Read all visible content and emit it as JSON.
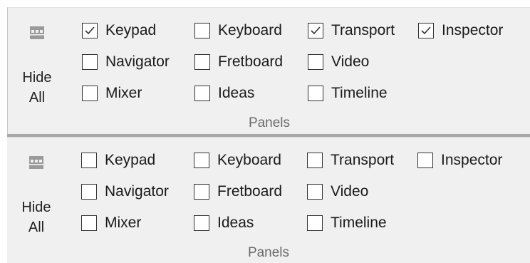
{
  "panels": [
    {
      "hide_all": {
        "label_line1": "Hide",
        "label_line2": "All",
        "icon": "panel-grid-icon"
      },
      "group_label": "Panels",
      "checkboxes": [
        {
          "label": "Keypad",
          "checked": true
        },
        {
          "label": "Keyboard",
          "checked": false
        },
        {
          "label": "Transport",
          "checked": true
        },
        {
          "label": "Inspector",
          "checked": true
        },
        {
          "label": "Navigator",
          "checked": false
        },
        {
          "label": "Fretboard",
          "checked": false
        },
        {
          "label": "Video",
          "checked": false
        },
        {
          "label": "Mixer",
          "checked": false
        },
        {
          "label": "Ideas",
          "checked": false
        },
        {
          "label": "Timeline",
          "checked": false
        }
      ]
    },
    {
      "hide_all": {
        "label_line1": "Hide",
        "label_line2": "All",
        "icon": "panel-grid-icon"
      },
      "group_label": "Panels",
      "checkboxes": [
        {
          "label": "Keypad",
          "checked": false
        },
        {
          "label": "Keyboard",
          "checked": false
        },
        {
          "label": "Transport",
          "checked": false
        },
        {
          "label": "Inspector",
          "checked": false
        },
        {
          "label": "Navigator",
          "checked": false
        },
        {
          "label": "Fretboard",
          "checked": false
        },
        {
          "label": "Video",
          "checked": false
        },
        {
          "label": "Mixer",
          "checked": false
        },
        {
          "label": "Ideas",
          "checked": false
        },
        {
          "label": "Timeline",
          "checked": false
        }
      ]
    }
  ]
}
